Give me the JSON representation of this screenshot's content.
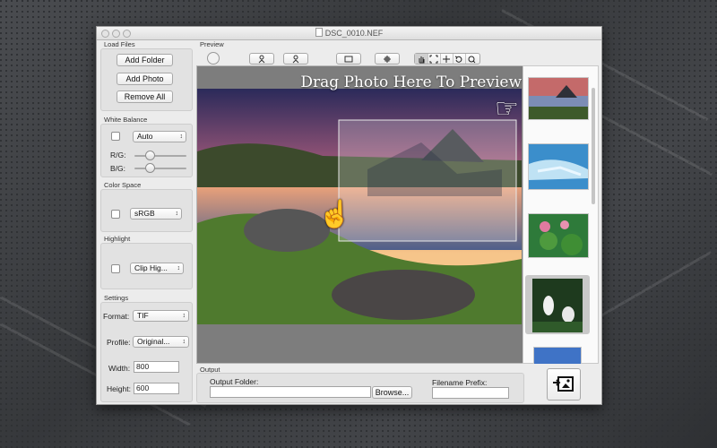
{
  "window": {
    "title": "DSC_0010.NEF"
  },
  "load_files": {
    "label": "Load Files",
    "add_folder": "Add Folder",
    "add_photo": "Add Photo",
    "remove_all": "Remove All"
  },
  "white_balance": {
    "label": "White Balance",
    "mode": "Auto",
    "rg_label": "R/G:",
    "bg_label": "B/G:",
    "rg_level": 0.3,
    "bg_level": 0.3
  },
  "color_space": {
    "label": "Color Space",
    "value": "sRGB"
  },
  "highlight": {
    "label": "Highlight",
    "value": "Clip Hig..."
  },
  "settings": {
    "label": "Settings",
    "format_label": "Format:",
    "format_value": "TIF",
    "profile_label": "Profile:",
    "profile_value": "Original...",
    "width_label": "Width:",
    "width_value": "800",
    "height_label": "Height:",
    "height_value": "600"
  },
  "preview": {
    "label": "Preview",
    "overlay_text": "Drag Photo Here To Preview"
  },
  "output": {
    "label": "Output",
    "folder_label": "Output Folder:",
    "folder_value": "",
    "browse": "Browse...",
    "prefix_label": "Filename Prefix:",
    "prefix_value": ""
  },
  "thumbnails": [
    "mountain-lake-sunset",
    "blue-ice-water",
    "pink-lotus-flowers",
    "white-herons",
    "blue-sky"
  ],
  "colors": {
    "window_bg": "#ececec",
    "preview_bg": "#7d7d7d",
    "selected_thumb": "#c9c9c9"
  }
}
